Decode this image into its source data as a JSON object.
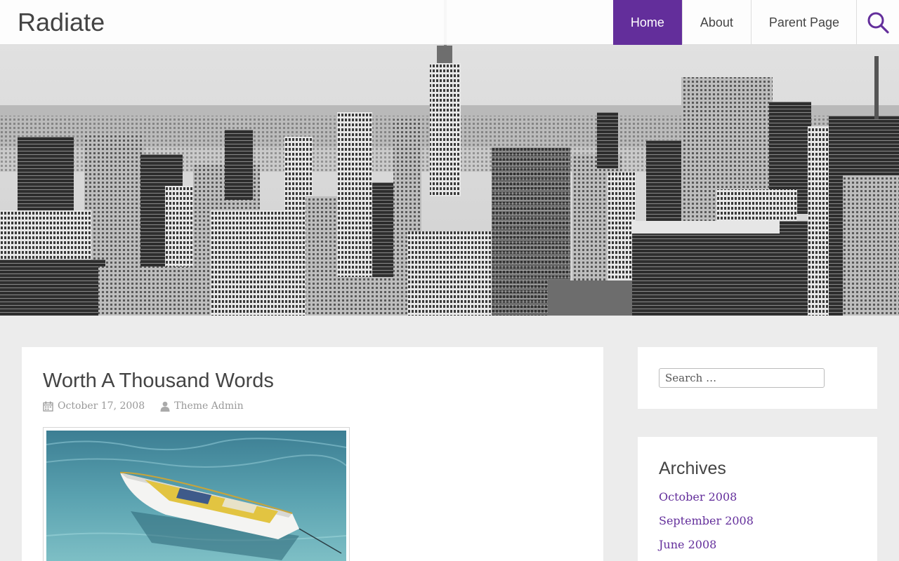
{
  "site": {
    "title": "Radiate",
    "accent_color": "#632e9b"
  },
  "nav": {
    "items": [
      {
        "label": "Home",
        "current": true
      },
      {
        "label": "About",
        "current": false
      },
      {
        "label": "Parent Page",
        "current": false
      }
    ],
    "search_icon": "search-icon"
  },
  "hero": {
    "image": "city-skyline-grayscale"
  },
  "post": {
    "title": "Worth A Thousand Words",
    "date": "October 17, 2008",
    "author": "Theme Admin",
    "date_icon": "calendar-icon",
    "author_icon": "user-icon",
    "image": "white-boat-on-water"
  },
  "sidebar": {
    "search": {
      "placeholder": "Search …"
    },
    "archives": {
      "title": "Archives",
      "items": [
        "October 2008",
        "September 2008",
        "June 2008"
      ]
    }
  }
}
